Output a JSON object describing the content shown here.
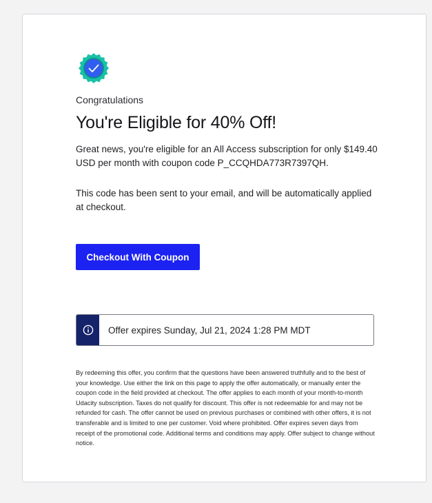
{
  "offer": {
    "eyebrow": "Congratulations",
    "title": "You're Eligible for 40% Off!",
    "message": "Great news, you're eligible for an All Access subscription for only $149.40 USD per month with coupon code P_CCQHDA773R7397QH.",
    "email_note": "This code has been sent to your email, and will be automatically applied at checkout.",
    "cta_label": "Checkout With Coupon",
    "expiry_text": "Offer expires Sunday, Jul 21, 2024 1:28 PM MDT",
    "terms": "By redeeming this offer, you confirm that the questions have been answered truthfully and to the best of your knowledge. Use either the link on this page to apply the offer automatically, or manually enter the coupon code in the field provided at checkout. The offer applies to each month of your month-to-month Udacity subscription. Taxes do not qualify for discount. This offer is not redeemable for and may not be refunded for cash. The offer cannot be used on previous purchases or combined with other offers, it is not transferable and is limited to one per customer. Void where prohibited. Offer expires seven days from receipt of the promotional code. Additional terms and conditions may apply. Offer subject to change without notice."
  },
  "icons": {
    "badge": "verified-badge-icon",
    "notice": "info-icon"
  },
  "colors": {
    "primary_button": "#1b22f2",
    "notice_icon_bg": "#15236b",
    "badge_outer": "#18c1a6",
    "badge_inner": "#2f5ef0"
  }
}
